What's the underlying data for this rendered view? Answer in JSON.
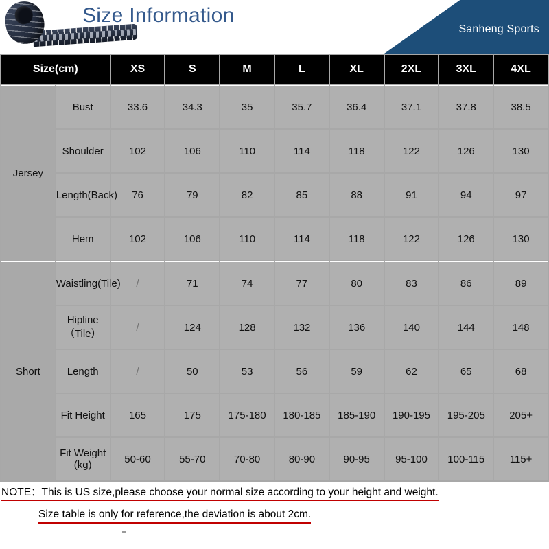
{
  "banner": {
    "title": "Size Information",
    "brand": "Sanheng Sports",
    "tape_icon": "measuring-tape-icon",
    "accent_blue": "#1d4e79",
    "title_blue": "#34598c"
  },
  "table": {
    "columns": [
      "Size(cm)",
      "XS",
      "S",
      "M",
      "L",
      "XL",
      "2XL",
      "3XL",
      "4XL"
    ],
    "groups": [
      {
        "name": "Jersey",
        "rows": [
          {
            "metric": "Bust",
            "values": [
              "33.6",
              "34.3",
              "35",
              "35.7",
              "36.4",
              "37.1",
              "37.8",
              "38.5"
            ]
          },
          {
            "metric": "Shoulder",
            "values": [
              "102",
              "106",
              "110",
              "114",
              "118",
              "122",
              "126",
              "130"
            ]
          },
          {
            "metric": "Length(Back)",
            "values": [
              "76",
              "79",
              "82",
              "85",
              "88",
              "91",
              "94",
              "97"
            ]
          },
          {
            "metric": "Hem",
            "values": [
              "102",
              "106",
              "110",
              "114",
              "118",
              "122",
              "126",
              "130"
            ]
          }
        ]
      },
      {
        "name": "Short",
        "rows": [
          {
            "metric": "Waistling(Tile)",
            "values": [
              "/",
              "71",
              "74",
              "77",
              "80",
              "83",
              "86",
              "89"
            ]
          },
          {
            "metric": "Hipline（Tile）",
            "values": [
              "/",
              "124",
              "128",
              "132",
              "136",
              "140",
              "144",
              "148"
            ]
          },
          {
            "metric": "Length",
            "values": [
              "/",
              "50",
              "53",
              "56",
              "59",
              "62",
              "65",
              "68"
            ]
          },
          {
            "metric": "Fit Height",
            "values": [
              "165",
              "175",
              "175-180",
              "180-185",
              "185-190",
              "190-195",
              "195-205",
              "205+"
            ]
          },
          {
            "metric": "Fit Weight (kg)",
            "values": [
              "50-60",
              "55-70",
              "70-80",
              "80-90",
              "90-95",
              "95-100",
              "100-115",
              "115+"
            ]
          }
        ]
      }
    ]
  },
  "notes": {
    "line1": "NOTE：This is US size,please choose your normal size according to your height and weight.",
    "line2": "Size table is only for reference,the deviation is about 2cm.",
    "underline_color": "#c00000"
  }
}
